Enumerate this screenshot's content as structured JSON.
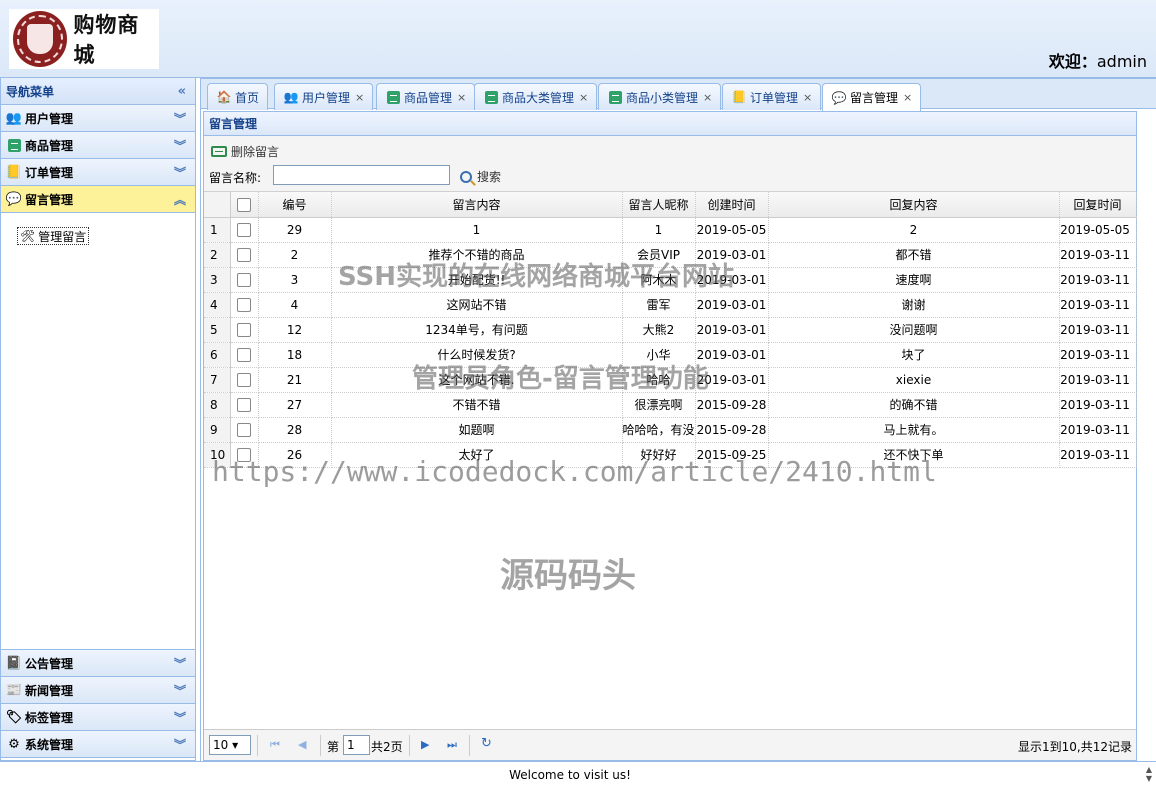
{
  "header": {
    "logo_text": "购物商城",
    "welcome_label": "欢迎：",
    "username": "admin"
  },
  "sidebar": {
    "title": "导航菜单",
    "sections_top": [
      {
        "label": "用户管理",
        "icon": "users-icon"
      },
      {
        "label": "商品管理",
        "icon": "grid-icon"
      },
      {
        "label": "订单管理",
        "icon": "folder-icon"
      },
      {
        "label": "留言管理",
        "icon": "speech-bubble-icon",
        "active": true
      }
    ],
    "sub_items": [
      {
        "label": "管理留言",
        "icon": "tools-icon"
      }
    ],
    "sections_bottom": [
      {
        "label": "公告管理",
        "icon": "notebook-icon"
      },
      {
        "label": "新闻管理",
        "icon": "newspaper-icon"
      },
      {
        "label": "标签管理",
        "icon": "tag-icon"
      },
      {
        "label": "系统管理",
        "icon": "gear-icon"
      }
    ]
  },
  "tabs": [
    {
      "label": "首页",
      "icon": "home-icon",
      "closable": false
    },
    {
      "label": "用户管理",
      "icon": "users-icon",
      "closable": true
    },
    {
      "label": "商品管理",
      "icon": "grid-icon",
      "closable": true
    },
    {
      "label": "商品大类管理",
      "icon": "grid-icon",
      "closable": true
    },
    {
      "label": "商品小类管理",
      "icon": "grid-icon",
      "closable": true
    },
    {
      "label": "订单管理",
      "icon": "folder-icon",
      "closable": true
    },
    {
      "label": "留言管理",
      "icon": "speech-bubble-icon",
      "closable": true,
      "active": true
    }
  ],
  "tab_close_glyph": "×",
  "panel": {
    "title": "留言管理",
    "delete_button": "删除留言",
    "search_label": "留言名称:",
    "search_value": "",
    "search_button": "搜索"
  },
  "table": {
    "columns": [
      "编号",
      "留言内容",
      "留言人昵称",
      "创建时间",
      "回复内容",
      "回复时间"
    ],
    "rows": [
      {
        "n": "1",
        "id": "29",
        "content": "1",
        "nick": "1",
        "created": "2019-05-05",
        "reply": "2",
        "reply_time": "2019-05-05"
      },
      {
        "n": "2",
        "id": "2",
        "content": "推荐个不错的商品",
        "nick": "会员VIP",
        "created": "2019-03-01",
        "reply": "都不错",
        "reply_time": "2019-03-11"
      },
      {
        "n": "3",
        "id": "3",
        "content": "开始配货!!",
        "nick": "阿木木",
        "created": "2019-03-01",
        "reply": "速度啊",
        "reply_time": "2019-03-11"
      },
      {
        "n": "4",
        "id": "4",
        "content": "这网站不错",
        "nick": "雷军",
        "created": "2019-03-01",
        "reply": "谢谢",
        "reply_time": "2019-03-11"
      },
      {
        "n": "5",
        "id": "12",
        "content": "1234单号，有问题",
        "nick": "大熊2",
        "created": "2019-03-01",
        "reply": "没问题啊",
        "reply_time": "2019-03-11"
      },
      {
        "n": "6",
        "id": "18",
        "content": "什么时候发货?",
        "nick": "小华",
        "created": "2019-03-01",
        "reply": "块了",
        "reply_time": "2019-03-11"
      },
      {
        "n": "7",
        "id": "21",
        "content": "这个网站不错.",
        "nick": "哈哈",
        "created": "2019-03-01",
        "reply": "xiexie",
        "reply_time": "2019-03-11"
      },
      {
        "n": "8",
        "id": "27",
        "content": "不错不错",
        "nick": "很漂亮啊",
        "created": "2015-09-28",
        "reply": "的确不错",
        "reply_time": "2019-03-11"
      },
      {
        "n": "9",
        "id": "28",
        "content": "如题啊",
        "nick": "哈哈哈，有没",
        "created": "2015-09-28",
        "reply": "马上就有。",
        "reply_time": "2019-03-11"
      },
      {
        "n": "10",
        "id": "26",
        "content": "太好了",
        "nick": "好好好",
        "created": "2015-09-25",
        "reply": "还不快下单",
        "reply_time": "2019-03-11"
      }
    ]
  },
  "pager": {
    "page_size": "10",
    "page_prefix": "第",
    "page_number": "1",
    "page_total": "共2页",
    "info": "显示1到10,共12记录"
  },
  "footer": {
    "text": "Welcome to visit us!"
  },
  "watermarks": [
    "SSH实现的在线网络商城平台网站",
    "管理员角色-留言管理功能",
    "https://www.icodedock.com/article/2410.html",
    "源码码头"
  ]
}
